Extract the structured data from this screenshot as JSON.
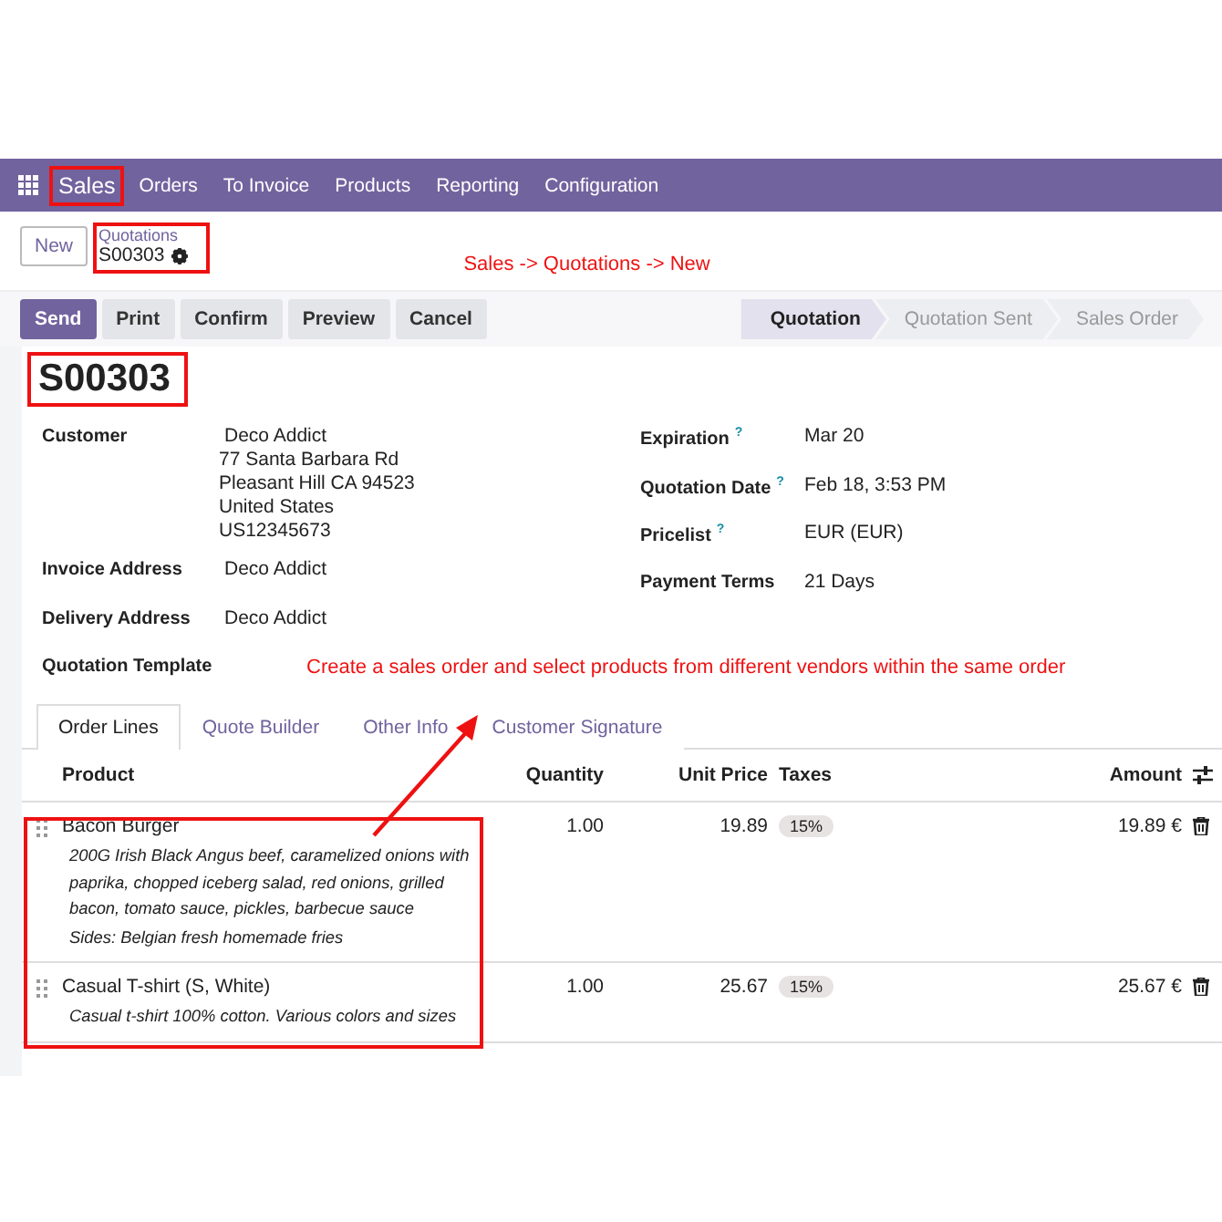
{
  "nav": {
    "items": [
      {
        "label": "Sales",
        "kind": "app",
        "highlighted": true
      },
      {
        "label": "Orders",
        "kind": "menu",
        "highlighted": false
      },
      {
        "label": "To Invoice",
        "kind": "menu",
        "highlighted": false
      },
      {
        "label": "Products",
        "kind": "menu",
        "highlighted": false
      },
      {
        "label": "Reporting",
        "kind": "menu",
        "highlighted": false
      },
      {
        "label": "Configuration",
        "kind": "menu",
        "highlighted": false
      }
    ]
  },
  "control_panel": {
    "new_button": "New",
    "breadcrumb": {
      "parent": "Quotations",
      "current": "S00303",
      "highlighted": true
    },
    "annotation": "Sales -> Quotations -> New"
  },
  "actions": [
    {
      "label": "Send",
      "primary": true
    },
    {
      "label": "Print",
      "primary": false
    },
    {
      "label": "Confirm",
      "primary": false
    },
    {
      "label": "Preview",
      "primary": false
    },
    {
      "label": "Cancel",
      "primary": false
    }
  ],
  "stages": [
    {
      "label": "Quotation",
      "selected": true
    },
    {
      "label": "Quotation Sent",
      "selected": false
    },
    {
      "label": "Sales Order",
      "selected": false
    }
  ],
  "form": {
    "title": "S00303",
    "title_highlighted": true,
    "left_fields": [
      {
        "label": "Customer",
        "lines": [
          "Deco Addict",
          "77 Santa Barbara Rd",
          "Pleasant Hill CA 94523",
          "United States",
          "US12345673"
        ]
      },
      {
        "label": "Invoice Address",
        "lines": [
          "Deco Addict"
        ]
      },
      {
        "label": "Delivery Address",
        "lines": [
          "Deco Addict"
        ]
      },
      {
        "label": "Quotation Template",
        "kind": "annotated"
      }
    ],
    "right_fields": [
      {
        "label": "Expiration",
        "help": "?",
        "value": "Mar 20"
      },
      {
        "label": "Quotation Date",
        "help": "?",
        "value": "Feb 18, 3:53 PM"
      },
      {
        "label": "Pricelist",
        "help": "?",
        "value": "EUR (EUR)"
      },
      {
        "label": "Payment Terms",
        "value": "21 Days"
      }
    ],
    "annotation": "Create a sales order and select products from different vendors within the same order"
  },
  "tabs": [
    {
      "label": "Order Lines",
      "selected": true
    },
    {
      "label": "Quote Builder",
      "selected": false
    },
    {
      "label": "Other Info",
      "selected": false
    },
    {
      "label": "Customer Signature",
      "selected": false
    }
  ],
  "table": {
    "columns": [
      "Product",
      "Quantity",
      "Unit Price",
      "Taxes",
      "Amount"
    ],
    "products_highlighted": true,
    "rows": [
      {
        "product": "Bacon Burger",
        "description": [
          "200G Irish Black Angus beef, caramelized onions with paprika, chopped iceberg salad, red onions, grilled bacon, tomato sauce, pickles, barbecue sauce",
          "Sides: Belgian fresh homemade fries"
        ],
        "quantity": "1.00",
        "unit_price": "19.89",
        "tax": "15%",
        "amount": "19.89 €"
      },
      {
        "product": "Casual T-shirt (S, White)",
        "description": [
          "Casual t-shirt 100% cotton. Various colors and sizes"
        ],
        "quantity": "1.00",
        "unit_price": "25.67",
        "tax": "15%",
        "amount": "25.67 €"
      }
    ]
  }
}
